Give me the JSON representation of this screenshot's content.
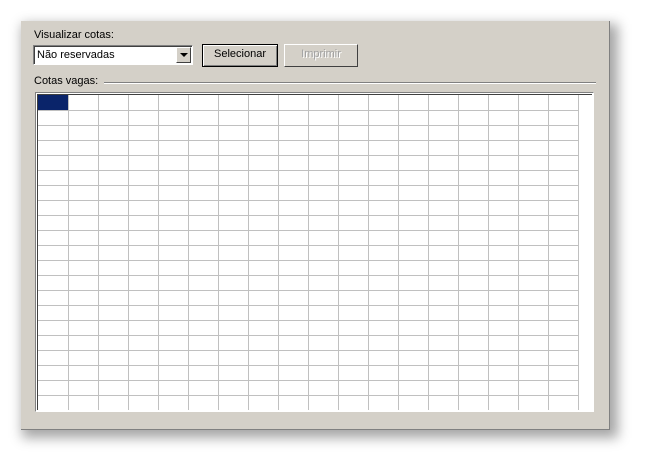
{
  "view_label": "Visualizar cotas:",
  "view_select": {
    "selected": "Não reservadas"
  },
  "buttons": {
    "select_label": "Selecionar",
    "print_label": "Imprimir"
  },
  "group_label": "Cotas vagas:",
  "grid": {
    "selected_cell": [
      0,
      0
    ],
    "cells": []
  },
  "colors": {
    "window_bg": "#d4d0c8",
    "selection": "#0a246a",
    "grid_lines": "#c0c0c0"
  }
}
